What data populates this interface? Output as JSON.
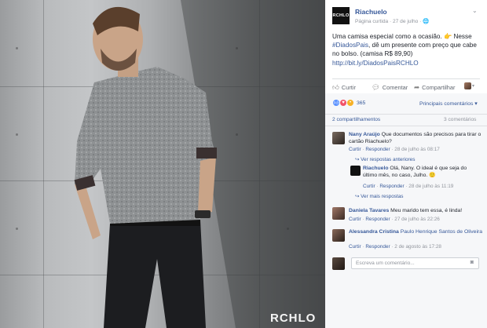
{
  "photo": {
    "brand_watermark": "RCHLO"
  },
  "post": {
    "page_logo_text": "RCHLO",
    "page_name": "Riachuelo",
    "meta": "Página curtida · 27 de julho · ",
    "globe_icon": "globe-icon",
    "text_part1": "Uma camisa especial como a ocasião. ",
    "hand_icon": "👉",
    "text_part2": " Nesse ",
    "hashtag": "#DiadosPais",
    "text_part3": ", dê um presente com preço que cabe no bolso. (camisa R$ 89,90) ",
    "link": "http://bit.ly/DiadosPaisRCHLO"
  },
  "actions": {
    "like": "Curtir",
    "comment": "Comentar",
    "share": "Compartilhar"
  },
  "reactions": {
    "count": "365",
    "top_comments": "Principais comentários ▾"
  },
  "stats": {
    "shares": "2 compartilhamentos",
    "comments": "3 comentários"
  },
  "comments": [
    {
      "name": "Nany Araújo",
      "text": " Que documentos são precisos para tirar o cartão Riachuelo?",
      "like": "Curtir",
      "reply": "Responder",
      "time": "28 de julho às 08:17",
      "more_replies": "Ver respostas anteriores",
      "reply_item": {
        "name": "Riachuelo",
        "text": " Olá, Nany. O ideal é que seja do último mês, no caso, Julho. ",
        "emoji": "🙂",
        "like": "Curtir",
        "reply": "Responder",
        "time": "28 de julho às 11:19"
      },
      "see_more": "Ver mais respostas"
    },
    {
      "name": "Daniela Tavares",
      "text": " Meu marido tem essa, é linda!",
      "like": "Curtir",
      "reply": "Responder",
      "time": "27 de julho às 22:26"
    },
    {
      "name": "Alessandra Cristina",
      "tag": "Paulo Henrique Santos de Oliveira",
      "like": "Curtir",
      "reply": "Responder",
      "time": "2 de agosto às 17:28"
    }
  ],
  "composer": {
    "placeholder": "Escreva um comentário..."
  }
}
